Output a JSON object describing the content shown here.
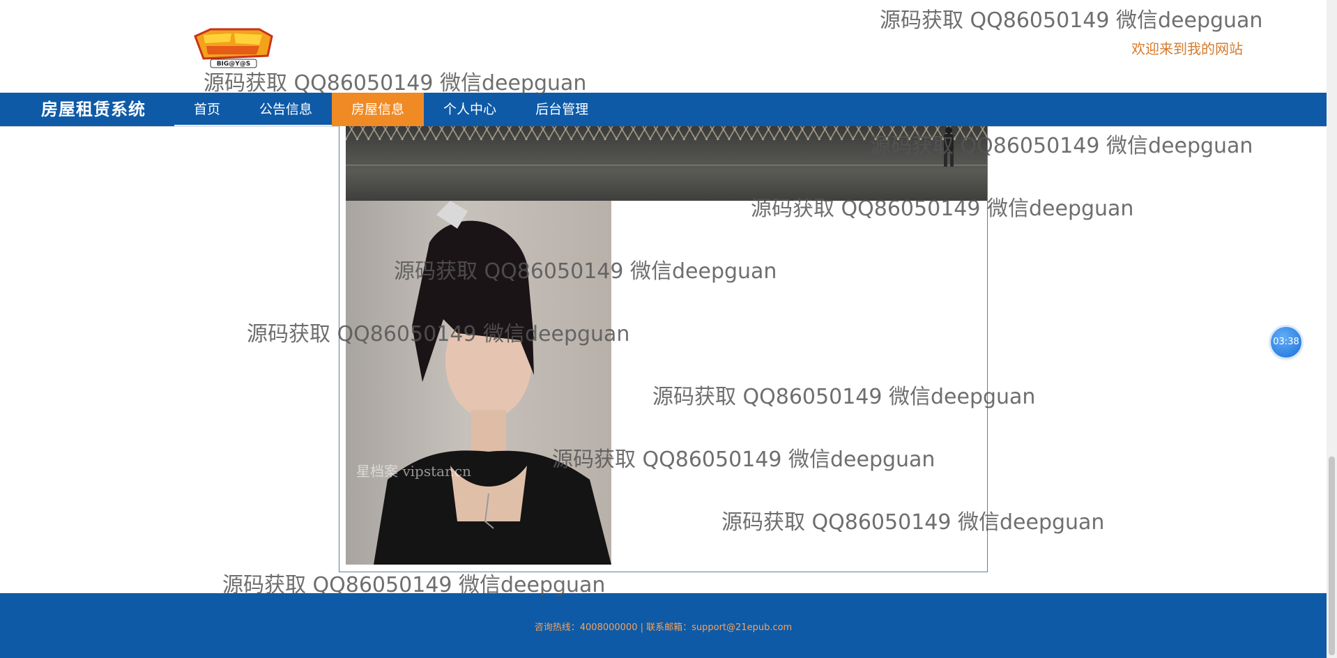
{
  "header": {
    "logo_text": "BIG@Y@S",
    "welcome": "欢迎来到我的网站"
  },
  "navbar": {
    "brand": "房屋租赁系统",
    "items": [
      {
        "label": "首页",
        "active": false
      },
      {
        "label": "公告信息",
        "active": false
      },
      {
        "label": "房屋信息",
        "active": true
      },
      {
        "label": "个人中心",
        "active": false
      },
      {
        "label": "后台管理",
        "active": false
      }
    ]
  },
  "content": {
    "photo_watermark": "星档案 vipstar.cn"
  },
  "footer": {
    "text": "咨询热线：4008000000 | 联系邮箱：support@21epub.com"
  },
  "timer": "03:38",
  "watermark_text": "源码获取 QQ86050149 微信deepguan",
  "colors": {
    "nav_bg": "#0e5aa7",
    "nav_active": "#f08a24",
    "welcome": "#d57b2b",
    "footer_text": "#f6a35a"
  }
}
